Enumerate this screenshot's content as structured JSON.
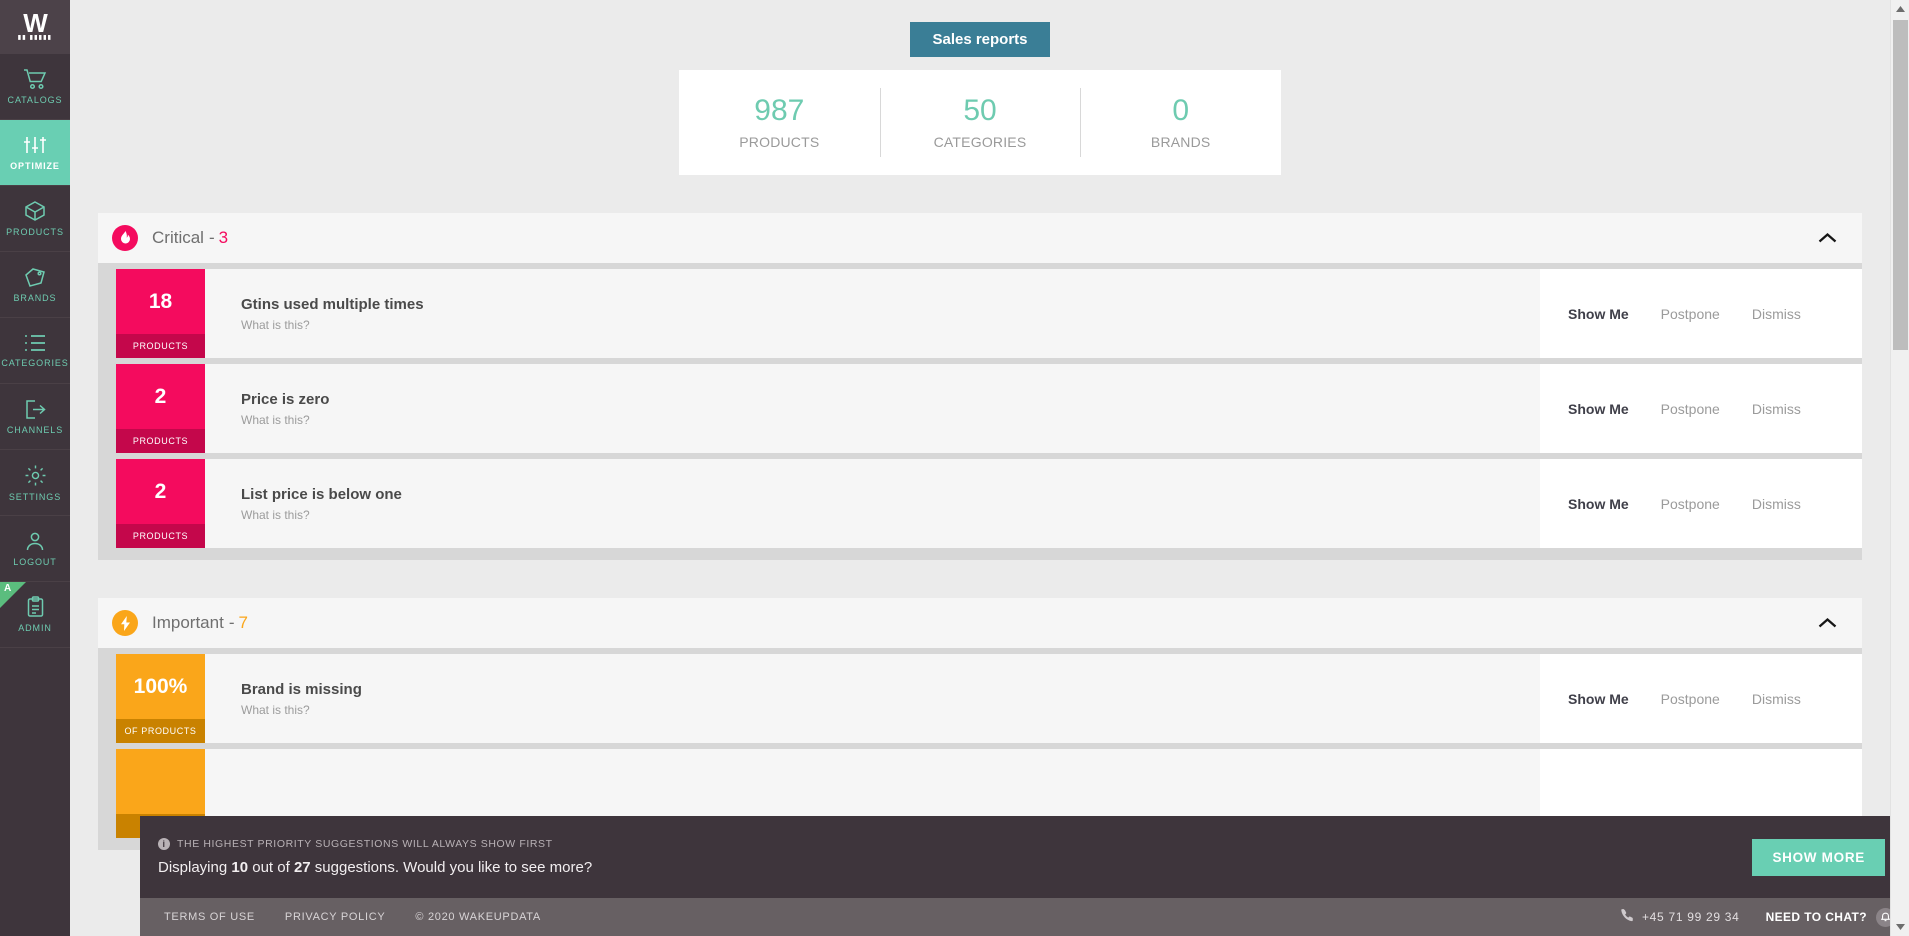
{
  "sidebar": {
    "logo": {
      "main": "W",
      "sub": "WAKEUPDATA"
    },
    "items": [
      {
        "label": "CATALOGS",
        "icon": "cart-icon",
        "active": false
      },
      {
        "label": "OPTIMIZE",
        "icon": "sliders-icon",
        "active": true
      },
      {
        "label": "PRODUCTS",
        "icon": "box-icon",
        "active": false
      },
      {
        "label": "BRANDS",
        "icon": "tag-icon",
        "active": false
      },
      {
        "label": "CATEGORIES",
        "icon": "list-icon",
        "active": false
      },
      {
        "label": "CHANNELS",
        "icon": "export-icon",
        "active": false
      },
      {
        "label": "SETTINGS",
        "icon": "gear-icon",
        "active": false
      },
      {
        "label": "LOGOUT",
        "icon": "user-icon",
        "active": false
      },
      {
        "label": "ADMIN",
        "icon": "clipboard-icon",
        "active": false,
        "corner_badge": "A"
      }
    ]
  },
  "header": {
    "sales_reports_button": "Sales reports",
    "stats": [
      {
        "value": "987",
        "label": "PRODUCTS"
      },
      {
        "value": "50",
        "label": "CATEGORIES"
      },
      {
        "value": "0",
        "label": "BRANDS"
      }
    ]
  },
  "sections": [
    {
      "id": "critical",
      "title": "Critical",
      "separator": "-",
      "count": "3",
      "icon": "flame-icon",
      "accent": "#f40b5e",
      "collapse_icon": "chevron-up-icon",
      "rows": [
        {
          "badge_value": "18",
          "badge_unit": "PRODUCTS",
          "title": "Gtins used multiple times",
          "subtitle": "What is this?",
          "actions": {
            "primary": "Show Me",
            "postpone": "Postpone",
            "dismiss": "Dismiss"
          }
        },
        {
          "badge_value": "2",
          "badge_unit": "PRODUCTS",
          "title": "Price is zero",
          "subtitle": "What is this?",
          "actions": {
            "primary": "Show Me",
            "postpone": "Postpone",
            "dismiss": "Dismiss"
          }
        },
        {
          "badge_value": "2",
          "badge_unit": "PRODUCTS",
          "title": "List price is below one",
          "subtitle": "What is this?",
          "actions": {
            "primary": "Show Me",
            "postpone": "Postpone",
            "dismiss": "Dismiss"
          }
        }
      ]
    },
    {
      "id": "important",
      "title": "Important",
      "separator": "-",
      "count": "7",
      "icon": "bolt-icon",
      "accent": "#faa61a",
      "collapse_icon": "chevron-up-icon",
      "rows": [
        {
          "badge_value": "100%",
          "badge_unit": "OF PRODUCTS",
          "title": "Brand is missing",
          "subtitle": "What is this?",
          "actions": {
            "primary": "Show Me",
            "postpone": "Postpone",
            "dismiss": "Dismiss"
          }
        },
        {
          "badge_value": "",
          "badge_unit": "",
          "title": "",
          "subtitle": "",
          "actions": {
            "primary": "",
            "postpone": "",
            "dismiss": ""
          }
        }
      ]
    }
  ],
  "notice": {
    "info_icon": "info-icon",
    "hint": "THE HIGHEST PRIORITY SUGGESTIONS WILL ALWAYS SHOW FIRST",
    "message_prefix": "Displaying",
    "shown_count": "10",
    "message_middle": "out of",
    "total_count": "27",
    "message_suffix": "suggestions. Would you like to see more?",
    "show_more_button": "SHOW MORE"
  },
  "footer": {
    "terms": "TERMS OF USE",
    "privacy": "PRIVACY POLICY",
    "copyright": "© 2020 WAKEUPDATA",
    "phone": "+45 71 99 29 34",
    "phone_icon": "phone-icon",
    "chat_label": "NEED TO CHAT?",
    "chat_icon": "chat-bubble-icon"
  },
  "colors": {
    "sidebar_bg": "#3e353c",
    "accent_teal": "#69cfb3",
    "accent_blue": "#3a7e96",
    "critical": "#f40b5e",
    "important": "#faa61a"
  }
}
